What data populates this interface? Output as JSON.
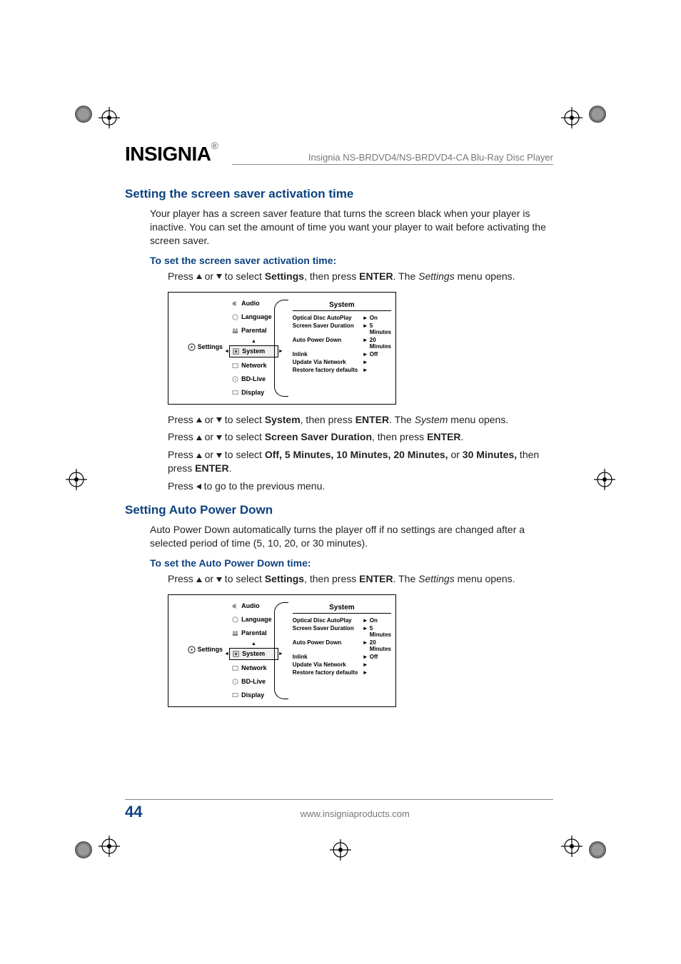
{
  "header": {
    "brand": "INSIGNIA",
    "product": "Insignia NS-BRDVD4/NS-BRDVD4-CA Blu-Ray Disc Player"
  },
  "section1": {
    "heading": "Setting the screen saver activation time",
    "intro": "Your player has a screen saver feature that turns the screen black when your player is inactive. You can set the amount of time you want your player to wait before activating the screen saver.",
    "subheading": "To set the screen saver activation time:",
    "step1_a": "Press ",
    "step1_b": " or ",
    "step1_c": " to select ",
    "step1_settings": "Settings",
    "step1_d": ", then press ",
    "step1_enter": "ENTER",
    "step1_e": ". The ",
    "step1_settingsit": "Settings",
    "step1_f": " menu opens.",
    "step2_a": "Press ",
    "step2_b": " or ",
    "step2_c": " to select ",
    "step2_system": "System",
    "step2_d": ", then press ",
    "step2_enter": "ENTER",
    "step2_e": ". The ",
    "step2_systemit": "System",
    "step2_f": " menu opens.",
    "step3_a": "Press ",
    "step3_b": " or ",
    "step3_c": " to select ",
    "step3_ssd": "Screen Saver Duration",
    "step3_d": ", then press ",
    "step3_enter": "ENTER",
    "step3_e": ".",
    "step4_a": "Press ",
    "step4_b": " or ",
    "step4_c": " to select ",
    "step4_opts": "Off, 5 Minutes, 10 Minutes, 20 Minutes,",
    "step4_d": " or ",
    "step4_opts2": "30 Minutes,",
    "step4_e": " then press ",
    "step4_enter": "ENTER",
    "step4_f": ".",
    "step5_a": "Press ",
    "step5_b": " to go to the previous menu."
  },
  "section2": {
    "heading": "Setting Auto Power Down",
    "intro": "Auto Power Down automatically turns the player off if no settings are changed after a selected period of time (5, 10, 20, or 30 minutes).",
    "subheading": "To set the Auto Power Down time:",
    "step1_a": "Press ",
    "step1_b": " or ",
    "step1_c": " to select ",
    "step1_settings": "Settings",
    "step1_d": ", then press ",
    "step1_enter": "ENTER",
    "step1_e": ". The ",
    "step1_settingsit": "Settings",
    "step1_f": " menu opens."
  },
  "menu": {
    "main": "Settings",
    "items": [
      "Audio",
      "Language",
      "Parental",
      "System",
      "Network",
      "BD-Live",
      "Display"
    ],
    "panel_title": "System",
    "rows": [
      {
        "label": "Optical Disc AutoPlay",
        "val": "On"
      },
      {
        "label": "Screen Saver Duration",
        "val": "5 Minutes"
      },
      {
        "label": "Auto Power Down",
        "val": "20 Minutes"
      },
      {
        "label": "Inlink",
        "val": "Off"
      },
      {
        "label": "Update Via Network",
        "val": ""
      },
      {
        "label": "Restore factory defaults",
        "val": ""
      }
    ]
  },
  "footer": {
    "page": "44",
    "url": "www.insigniaproducts.com"
  }
}
